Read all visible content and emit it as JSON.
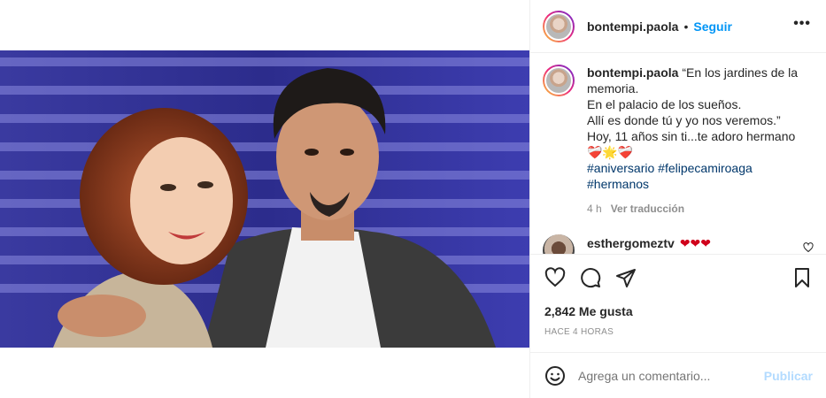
{
  "header": {
    "username": "bontempi.paola",
    "dot": "•",
    "follow_label": "Seguir",
    "more_label": "•••"
  },
  "caption": {
    "username": "bontempi.paola",
    "lines": [
      "“En los jardines de la",
      "memoria.",
      "En el palacio de los sueños.",
      "Allí es donde tú y yo nos veremos.”",
      "Hoy, 11 años sin ti...te adoro hermano"
    ],
    "emoji_line": "❤️‍🩹🌟❤️‍🩹",
    "hashtags_line1": [
      "#aniversario",
      "#felipecamiroaga"
    ],
    "hashtags_line2": [
      "#hermanos"
    ],
    "time": "4 h",
    "translate_label": "Ver traducción"
  },
  "comment": {
    "username": "esthergomeztv",
    "text": "❤❤❤"
  },
  "actions": {
    "likes": "2,842 Me gusta",
    "time_ago": "HACE 4 HORAS"
  },
  "add_comment": {
    "placeholder": "Agrega un comentario...",
    "publish_label": "Publicar"
  },
  "colors": {
    "accent_blue": "#0095f6",
    "publish_disabled": "#b3dbff",
    "heart_red": "#d0021b",
    "muted": "#8e8e8e"
  }
}
